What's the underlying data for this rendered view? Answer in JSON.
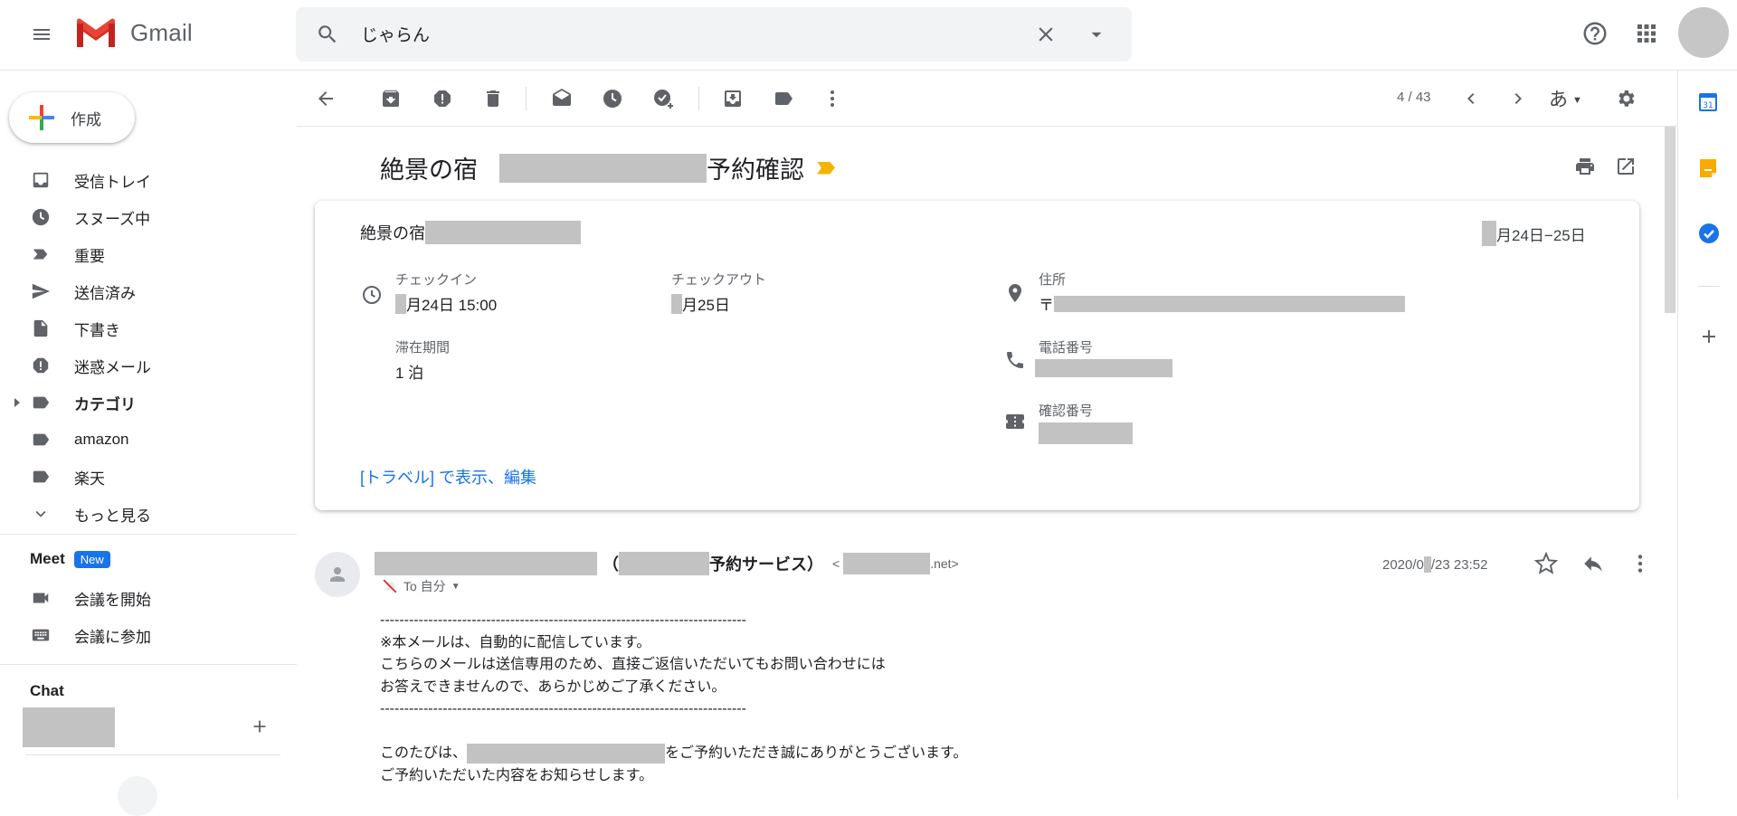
{
  "app": {
    "title": "Gmail"
  },
  "search": {
    "query": "じゃらん"
  },
  "sidebar": {
    "compose_label": "作成",
    "items": [
      {
        "label": "受信トレイ",
        "icon": "inbox-icon"
      },
      {
        "label": "スヌーズ中",
        "icon": "clock-icon"
      },
      {
        "label": "重要",
        "icon": "important-icon"
      },
      {
        "label": "送信済み",
        "icon": "send-icon"
      },
      {
        "label": "下書き",
        "icon": "draft-icon"
      },
      {
        "label": "迷惑メール",
        "icon": "spam-icon"
      },
      {
        "label": "カテゴリ",
        "icon": "label-icon"
      },
      {
        "label": "amazon",
        "icon": "label-icon"
      },
      {
        "label": "楽天",
        "icon": "label-icon"
      },
      {
        "label": "もっと見る",
        "icon": "chevron-down-icon"
      }
    ],
    "meet": {
      "title": "Meet",
      "badge": "New",
      "start": "会議を開始",
      "join": "会議に参加"
    },
    "chat": {
      "title": "Chat"
    }
  },
  "toolbar": {
    "page_count": "4 / 43",
    "input_tool": "あ"
  },
  "email": {
    "subject_prefix": "絶景の宿",
    "subject_suffix": "予約確認",
    "card": {
      "hotel_prefix": "絶景の宿",
      "date_range": "月24日−25日",
      "checkin_label": "チェックイン",
      "checkin_value": "月24日 15:00",
      "checkout_label": "チェックアウト",
      "checkout_value": "月25日",
      "stay_label": "滞在期間",
      "stay_value": "1 泊",
      "address_label": "住所",
      "address_value": "〒",
      "phone_label": "電話番号",
      "confirm_label": "確認番号",
      "link": "[トラベル] で表示、編集"
    },
    "sender": {
      "open_paren": "（",
      "service_suffix": "予約サービス）",
      "email_open": "<",
      "email_suffix": ".net>",
      "to": "To 自分",
      "date_prefix": "2020/0",
      "date_suffix": "/23 23:52"
    },
    "body": {
      "separator": "----------------------------------------------------------------------------",
      "line1": "※本メールは、自動的に配信しています。",
      "line2": "こちらのメールは送信専用のため、直接ご返信いただいてもお問い合わせには",
      "line3": "お答えできませんので、あらかじめご了承ください。",
      "line4_prefix": "このたびは、",
      "line4_suffix": "をご予約いただき誠にありがとうございます。",
      "line5": "ご予約いただいた内容をお知らせします。"
    }
  },
  "colors": {
    "accent": "#1a73e8",
    "tag": "#f4b400",
    "redaction": "#c2c2c2"
  }
}
